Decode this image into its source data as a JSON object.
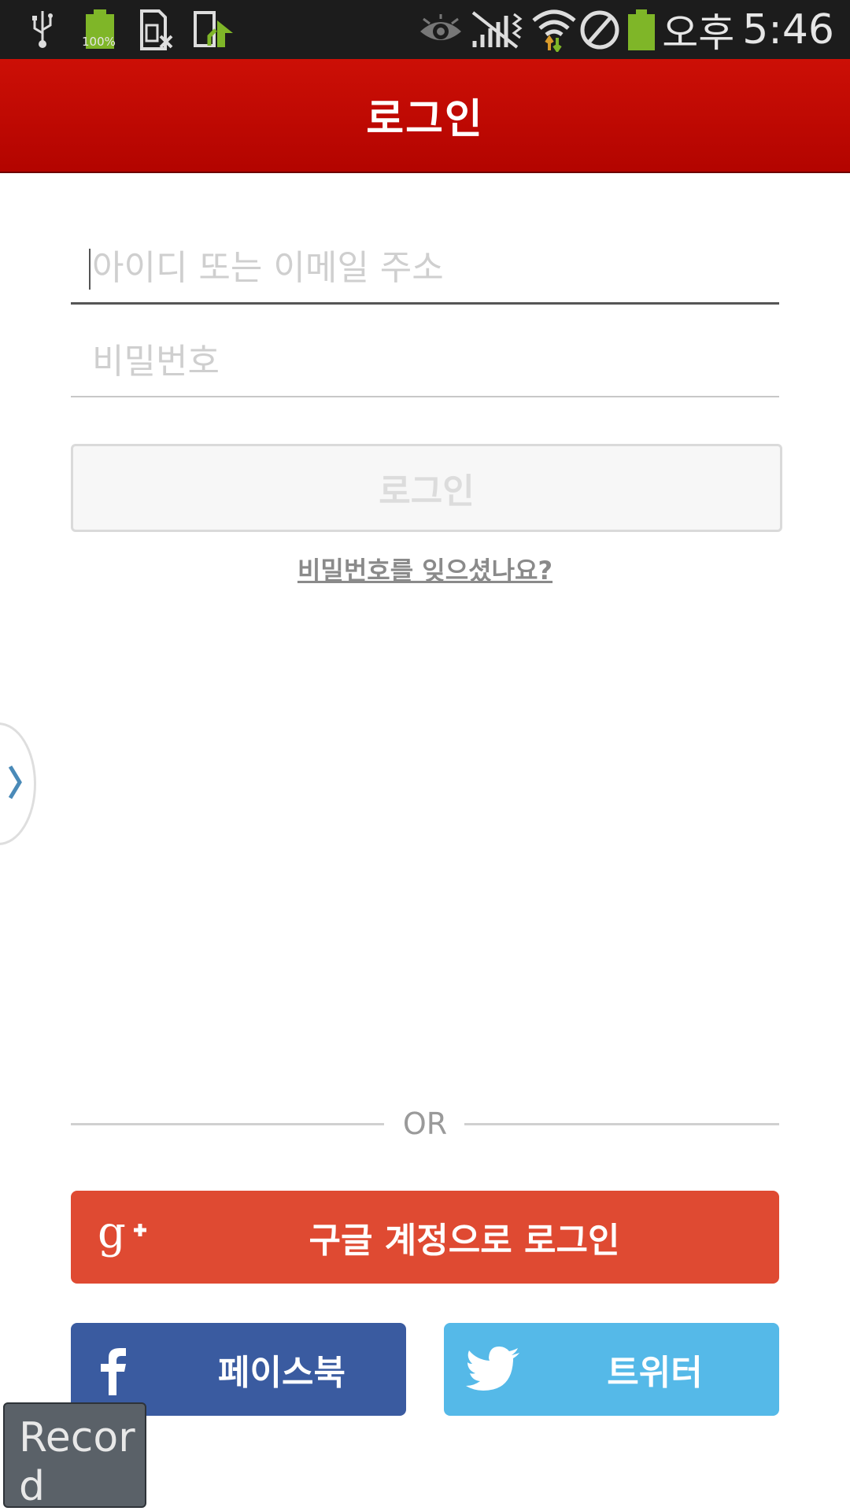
{
  "status_bar": {
    "battery_level_text": "100%",
    "ampm": "오후",
    "time": "5:46",
    "icons": [
      "usb-icon",
      "battery-full-icon",
      "sim-missing-icon",
      "upload-icon",
      "eye-icon",
      "no-signal-icon",
      "wifi-icon",
      "block-icon",
      "battery-icon"
    ]
  },
  "header": {
    "title": "로그인"
  },
  "form": {
    "id_placeholder": "아이디 또는 이메일 주소",
    "password_placeholder": "비밀번호",
    "login_label": "로그인",
    "forgot_label": "비밀번호를 잊으셨나요?"
  },
  "divider": {
    "or_label": "OR"
  },
  "social": {
    "google_label": "구글 계정으로 로그인",
    "facebook_label": "페이스북",
    "twitter_label": "트위터"
  },
  "overlay": {
    "record_label": "Record"
  },
  "colors": {
    "header_red": "#c40a03",
    "google": "#df4a32",
    "facebook": "#3a5ba0",
    "twitter": "#55b9e8"
  }
}
